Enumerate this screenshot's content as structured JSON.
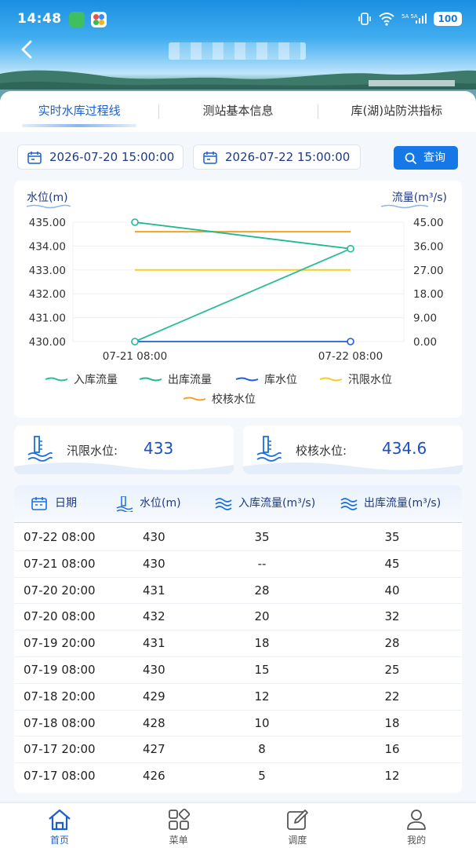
{
  "status_bar": {
    "time": "14:48",
    "battery": "100",
    "signal_text": "5A 5A"
  },
  "tabs": [
    {
      "label": "实时水库过程线",
      "active": true
    },
    {
      "label": "测站基本信息",
      "active": false
    },
    {
      "label": "库(湖)站防洪指标",
      "active": false
    }
  ],
  "filter": {
    "start": "2026-07-20 15:00:00",
    "end": "2026-07-22 15:00:00",
    "query_label": "查询"
  },
  "chart_data": {
    "type": "line",
    "ylabel_left": "水位(m)",
    "ylabel_right": "流量(m³/s)",
    "x": [
      "07-21 08:00",
      "07-22 08:00"
    ],
    "y_left_ticks": [
      "435.00",
      "434.00",
      "433.00",
      "432.00",
      "431.00",
      "430.00"
    ],
    "y_right_ticks": [
      "45.00",
      "36.00",
      "27.00",
      "18.00",
      "9.00",
      "0.00"
    ],
    "ylim_left": [
      430,
      435
    ],
    "ylim_right": [
      0,
      45
    ],
    "series": [
      {
        "name": "入库流量",
        "axis": "right",
        "color": "#2bbd9a",
        "values": [
          0,
          35
        ]
      },
      {
        "name": "出库流量",
        "axis": "right",
        "color": "#1fb98f",
        "values": [
          45,
          35
        ]
      },
      {
        "name": "库水位",
        "axis": "left",
        "color": "#1f5be0",
        "values": [
          430,
          430
        ]
      },
      {
        "name": "汛限水位",
        "axis": "left",
        "color": "#f5cf1a",
        "values": [
          433,
          433
        ]
      },
      {
        "name": "校核水位",
        "axis": "left",
        "color": "#f5a02a",
        "values": [
          434.6,
          434.6
        ]
      }
    ],
    "grid": true,
    "legend_position": "bottom"
  },
  "limits": {
    "flood_limit_label": "汛限水位:",
    "flood_limit_value": "433",
    "check_level_label": "校核水位:",
    "check_level_value": "434.6"
  },
  "table": {
    "headers": {
      "date": "日期",
      "level": "水位(m)",
      "inflow": "入库流量(m³/s)",
      "outflow": "出库流量(m³/s)"
    },
    "rows": [
      {
        "date": "07-22 08:00",
        "level": "430",
        "inflow": "35",
        "outflow": "35"
      },
      {
        "date": "07-21 08:00",
        "level": "430",
        "inflow": "--",
        "outflow": "45"
      },
      {
        "date": "07-20 20:00",
        "level": "431",
        "inflow": "28",
        "outflow": "40"
      },
      {
        "date": "07-20 08:00",
        "level": "432",
        "inflow": "20",
        "outflow": "32"
      },
      {
        "date": "07-19 20:00",
        "level": "431",
        "inflow": "18",
        "outflow": "28"
      },
      {
        "date": "07-19 08:00",
        "level": "430",
        "inflow": "15",
        "outflow": "25"
      },
      {
        "date": "07-18 20:00",
        "level": "429",
        "inflow": "12",
        "outflow": "22"
      },
      {
        "date": "07-18 08:00",
        "level": "428",
        "inflow": "10",
        "outflow": "18"
      },
      {
        "date": "07-17 20:00",
        "level": "427",
        "inflow": "8",
        "outflow": "16"
      },
      {
        "date": "07-17 08:00",
        "level": "426",
        "inflow": "5",
        "outflow": "12"
      }
    ]
  },
  "bottom_nav": [
    {
      "label": "首页",
      "icon": "home-icon",
      "active": true
    },
    {
      "label": "菜单",
      "icon": "grid-icon",
      "active": false
    },
    {
      "label": "调度",
      "icon": "edit-icon",
      "active": false
    },
    {
      "label": "我的",
      "icon": "user-icon",
      "active": false
    }
  ]
}
